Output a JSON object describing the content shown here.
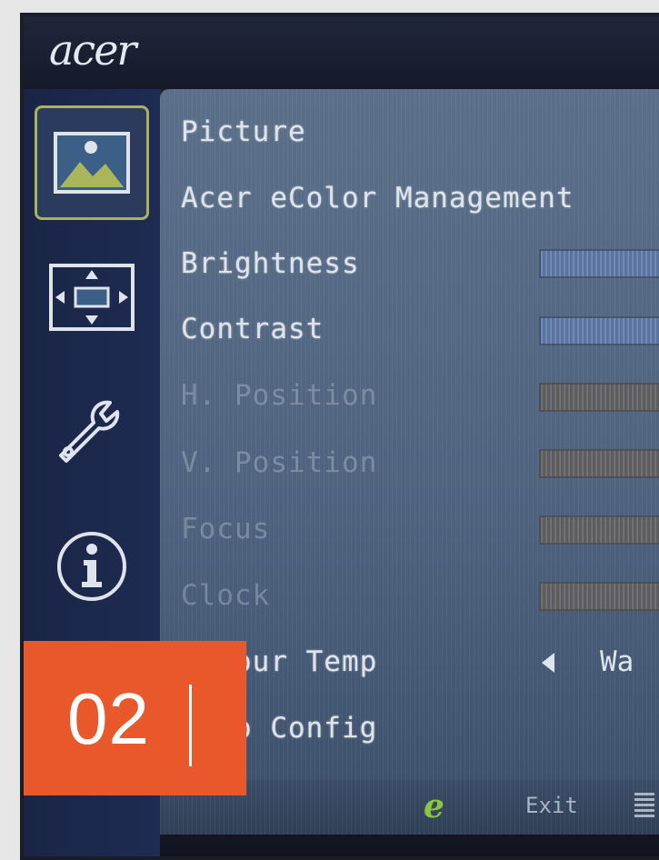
{
  "brand": {
    "logo": "acer"
  },
  "sidebar": {
    "items": [
      {
        "icon": "picture-icon",
        "active": true
      },
      {
        "icon": "position-icon",
        "active": false
      },
      {
        "icon": "wrench-icon",
        "active": false
      },
      {
        "icon": "info-icon",
        "active": false
      }
    ]
  },
  "menu": {
    "items": [
      {
        "label": "Picture",
        "enabled": true
      },
      {
        "label": "Acer eColor Management",
        "enabled": true
      },
      {
        "label": "Brightness",
        "enabled": true,
        "control": "slider"
      },
      {
        "label": "Contrast",
        "enabled": true,
        "control": "slider"
      },
      {
        "label": "H. Position",
        "enabled": false,
        "control": "slider"
      },
      {
        "label": "V. Position",
        "enabled": false,
        "control": "slider"
      },
      {
        "label": "Focus",
        "enabled": false,
        "control": "slider"
      },
      {
        "label": "Clock",
        "enabled": false,
        "control": "slider"
      },
      {
        "label": "Colour Temp",
        "enabled": true,
        "control": "selector",
        "value": "Wa"
      },
      {
        "label": "Auto Config",
        "enabled": true
      }
    ]
  },
  "footer": {
    "eco_label": "e",
    "exit_label": "Exit"
  },
  "badge": {
    "number": "02"
  },
  "colors": {
    "accent_orange": "#e8582a",
    "active_border": "#a8b35a",
    "eco_green": "#8cc43e"
  }
}
